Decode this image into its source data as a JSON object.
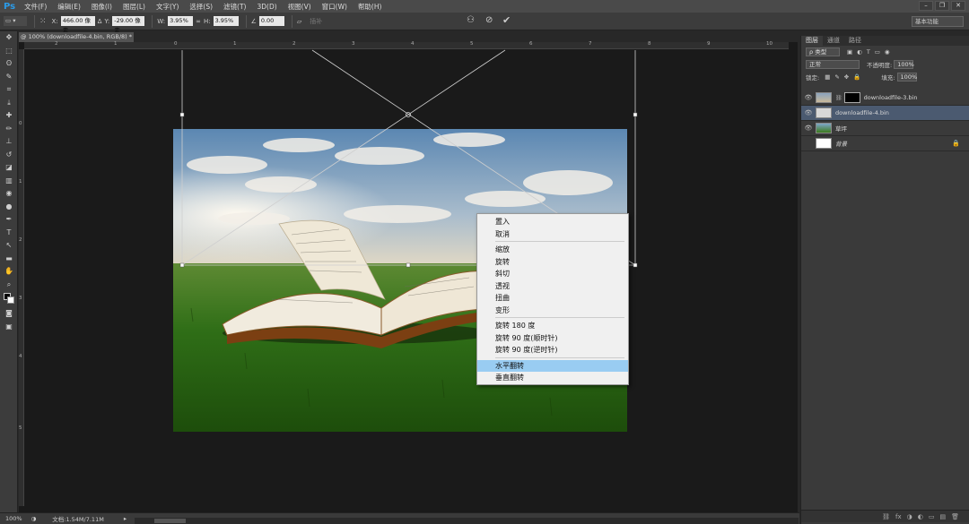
{
  "app": {
    "logo": "Ps"
  },
  "menu": [
    "文件(F)",
    "编辑(E)",
    "图像(I)",
    "图层(L)",
    "文字(Y)",
    "选择(S)",
    "滤镜(T)",
    "3D(D)",
    "视图(V)",
    "窗口(W)",
    "帮助(H)"
  ],
  "window_controls": [
    "–",
    "❐",
    "✕"
  ],
  "options": {
    "x_label": "X:",
    "x_value": "466.00 像素",
    "y_label": "Y:",
    "y_value": "-29.00 像素",
    "w_label": "W:",
    "w_value": "3.95%",
    "h_label": "H:",
    "h_value": "3.95%",
    "angle_label": "∠",
    "angle_value": "0.00",
    "interp_label": "插补",
    "workspace": "基本功能"
  },
  "document": {
    "tab_title": "@ 100% (downloadfile-4.bin, RGB/8) *",
    "close": "×"
  },
  "ruler": {
    "top_ticks": [
      "2",
      "1",
      "0",
      "1",
      "2",
      "3",
      "4",
      "5",
      "6",
      "7",
      "8",
      "9",
      "10"
    ],
    "left_ticks": [
      "0",
      "1",
      "2",
      "3",
      "4",
      "5"
    ]
  },
  "context_menu": {
    "group1": [
      "置入",
      "取消"
    ],
    "group2": [
      "缩放",
      "旋转",
      "斜切",
      "透视",
      "扭曲",
      "变形"
    ],
    "group3": [
      "旋转 180 度",
      "旋转 90 度(顺时针)",
      "旋转 90 度(逆时针)"
    ],
    "group4": [
      "水平翻转",
      "垂直翻转"
    ],
    "selected": "水平翻转"
  },
  "panel": {
    "tabs": [
      "图层",
      "通道",
      "路径"
    ],
    "kind_filter": "ρ 类型",
    "blend_mode": "正常",
    "opacity_label": "不透明度:",
    "opacity_value": "100%",
    "lock_label": "锁定:",
    "fill_label": "填充:",
    "fill_value": "100%",
    "layers": [
      {
        "name": "downloadfile-3.bin",
        "visible": "👁"
      },
      {
        "name": "downloadfile-4.bin",
        "visible": "👁"
      },
      {
        "name": "草坪",
        "visible": "👁"
      },
      {
        "name": "背景",
        "visible": ""
      }
    ],
    "bottom_icons": [
      "⛓",
      "fx",
      "◑",
      "◐",
      "▭",
      "▤",
      "🗑"
    ]
  },
  "status": {
    "zoom": "100%",
    "doc_info": "文档:1.54M/7.11M"
  }
}
